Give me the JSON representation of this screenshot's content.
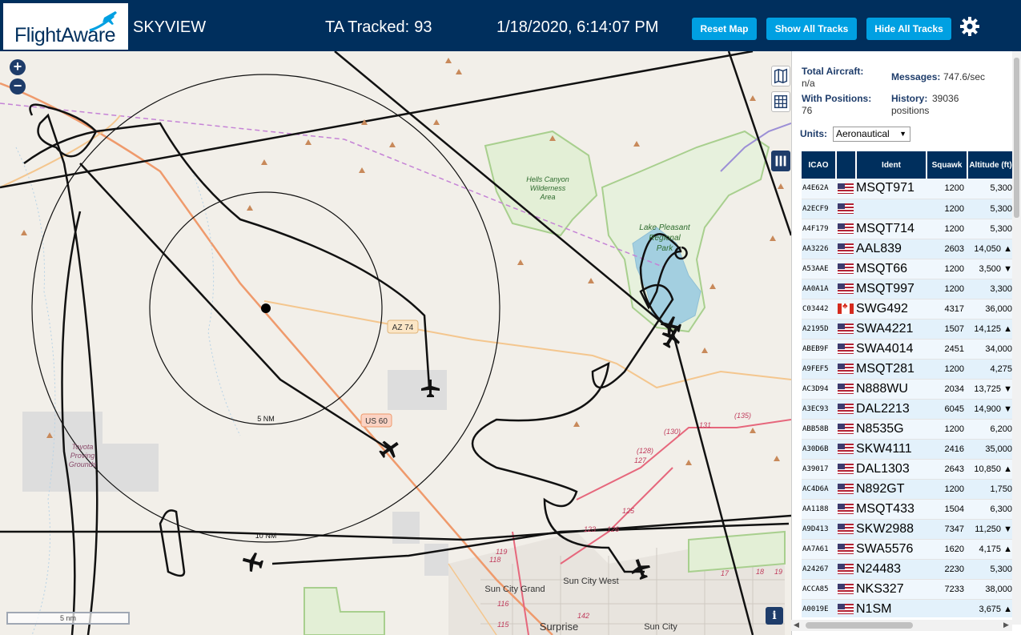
{
  "header": {
    "logo_text": "FlightAware",
    "app_name": "SKYVIEW",
    "tracked_label": "TA Tracked:",
    "tracked_count": "93",
    "datetime": "1/18/2020, 6:14:07 PM",
    "buttons": {
      "reset": "Reset Map",
      "show_all": "Show All Tracks",
      "hide_all": "Hide All Tracks"
    },
    "settings_icon": "gear-icon"
  },
  "map": {
    "zoom_in": "+",
    "zoom_out": "−",
    "info": "i",
    "scalebar": "5 nm",
    "ring_labels": {
      "inner": "5 NM",
      "outer": "10 NM"
    },
    "road_labels": {
      "az74": "AZ 74",
      "us60": "US 60"
    },
    "place_labels": {
      "hells_canyon_1": "Hells Canyon",
      "hells_canyon_2": "Wilderness",
      "hells_canyon_3": "Area",
      "lake_1": "Lake Pleasant",
      "lake_2": "Regional",
      "lake_3": "Park",
      "toyota_1": "Toyota",
      "toyota_2": "Proving",
      "toyota_3": "Grounds",
      "sun_city_grand": "Sun City Grand",
      "sun_city_west": "Sun City West",
      "surprise": "Surprise",
      "sun_city": "Sun City"
    },
    "route_numbers": [
      "(135)",
      "131",
      "(130)",
      "(128)",
      "127",
      "125",
      "123",
      "119",
      "118",
      "116",
      "115",
      "142",
      "126",
      "19",
      "18",
      "17"
    ]
  },
  "sidebar": {
    "total_aircraft_label": "Total Aircraft:",
    "total_aircraft_value": "n/a",
    "messages_label": "Messages:",
    "messages_value": "747.6/sec",
    "with_positions_label": "With Positions:",
    "with_positions_value": "76",
    "history_label": "History:",
    "history_value": "39036",
    "history_unit": "positions",
    "units_label": "Units:",
    "units_value": "Aeronautical",
    "columns": [
      "ICAO",
      "",
      "Ident",
      "Squawk",
      "Altitude (ft)"
    ],
    "rows": [
      {
        "icao": "A4E62A",
        "flag": "us",
        "ident": "MSQT971",
        "squawk": "1200",
        "alt": "5,300",
        "trend": ""
      },
      {
        "icao": "A2ECF9",
        "flag": "us",
        "ident": "",
        "squawk": "1200",
        "alt": "5,300",
        "trend": ""
      },
      {
        "icao": "A4F179",
        "flag": "us",
        "ident": "MSQT714",
        "squawk": "1200",
        "alt": "5,300",
        "trend": ""
      },
      {
        "icao": "AA3226",
        "flag": "us",
        "ident": "AAL839",
        "squawk": "2603",
        "alt": "14,050",
        "trend": "▲"
      },
      {
        "icao": "A53AAE",
        "flag": "us",
        "ident": "MSQT66",
        "squawk": "1200",
        "alt": "3,500",
        "trend": "▼"
      },
      {
        "icao": "AA0A1A",
        "flag": "us",
        "ident": "MSQT997",
        "squawk": "1200",
        "alt": "3,300",
        "trend": ""
      },
      {
        "icao": "C03442",
        "flag": "ca",
        "ident": "SWG492",
        "squawk": "4317",
        "alt": "36,000",
        "trend": ""
      },
      {
        "icao": "A2195D",
        "flag": "us",
        "ident": "SWA4221",
        "squawk": "1507",
        "alt": "14,125",
        "trend": "▲"
      },
      {
        "icao": "ABEB9F",
        "flag": "us",
        "ident": "SWA4014",
        "squawk": "2451",
        "alt": "34,000",
        "trend": ""
      },
      {
        "icao": "A9FEF5",
        "flag": "us",
        "ident": "MSQT281",
        "squawk": "1200",
        "alt": "4,275",
        "trend": ""
      },
      {
        "icao": "AC3D94",
        "flag": "us",
        "ident": "N888WU",
        "squawk": "2034",
        "alt": "13,725",
        "trend": "▼"
      },
      {
        "icao": "A3EC93",
        "flag": "us",
        "ident": "DAL2213",
        "squawk": "6045",
        "alt": "14,900",
        "trend": "▼"
      },
      {
        "icao": "ABB58B",
        "flag": "us",
        "ident": "N8535G",
        "squawk": "1200",
        "alt": "6,200",
        "trend": ""
      },
      {
        "icao": "A30D6B",
        "flag": "us",
        "ident": "SKW4111",
        "squawk": "2416",
        "alt": "35,000",
        "trend": ""
      },
      {
        "icao": "A39017",
        "flag": "us",
        "ident": "DAL1303",
        "squawk": "2643",
        "alt": "10,850",
        "trend": "▲"
      },
      {
        "icao": "AC4D6A",
        "flag": "us",
        "ident": "N892GT",
        "squawk": "1200",
        "alt": "1,750",
        "trend": ""
      },
      {
        "icao": "AA1188",
        "flag": "us",
        "ident": "MSQT433",
        "squawk": "1504",
        "alt": "6,300",
        "trend": ""
      },
      {
        "icao": "A9D413",
        "flag": "us",
        "ident": "SKW2988",
        "squawk": "7347",
        "alt": "11,250",
        "trend": "▼"
      },
      {
        "icao": "AA7A61",
        "flag": "us",
        "ident": "SWA5576",
        "squawk": "1620",
        "alt": "4,175",
        "trend": "▲"
      },
      {
        "icao": "A24267",
        "flag": "us",
        "ident": "N24483",
        "squawk": "2230",
        "alt": "5,300",
        "trend": ""
      },
      {
        "icao": "ACCA85",
        "flag": "us",
        "ident": "NKS327",
        "squawk": "7233",
        "alt": "38,000",
        "trend": ""
      },
      {
        "icao": "A0019E",
        "flag": "us",
        "ident": "N1SM",
        "squawk": "",
        "alt": "3,675",
        "trend": "▲"
      }
    ]
  },
  "colors": {
    "header_bg": "#002f5d",
    "button": "#00a0e2",
    "lake": "#a3cfe0",
    "park_border": "#a8cf8e",
    "track": "#111111"
  }
}
